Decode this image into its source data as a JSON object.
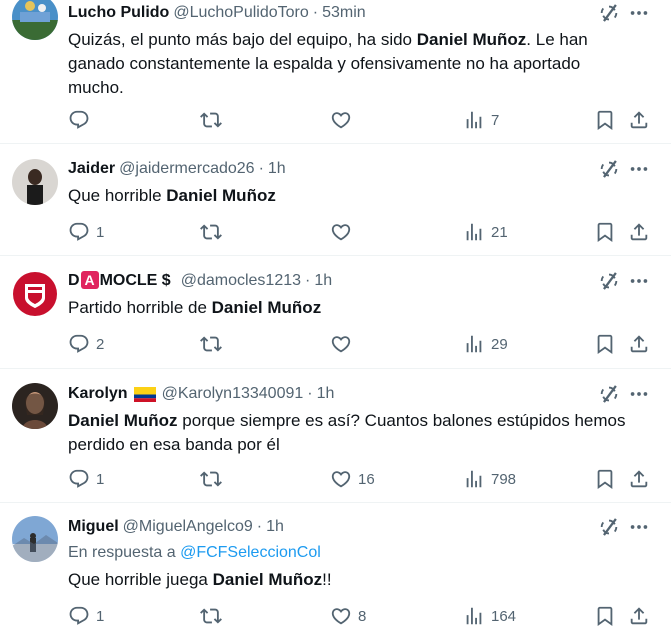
{
  "tweets": [
    {
      "name": "Lucho Pulido",
      "handle": "@LuchoPulidoToro",
      "time": "53min",
      "reply_to_prefix": "",
      "reply_to_handle": "",
      "body": [
        {
          "t": "Quizás, el punto más bajo del equipo, ha sido "
        },
        {
          "t": "Daniel Muñoz",
          "b": true
        },
        {
          "t": ". Le han ganado constantemente la espalda y ofensivamente no ha aportado mucho."
        }
      ],
      "replies": "",
      "retweets": "",
      "likes": "",
      "views": "7"
    },
    {
      "name": "Jaider",
      "handle": "@jaidermercado26",
      "time": "1h",
      "body": [
        {
          "t": "Que horrible "
        },
        {
          "t": "Daniel Muñoz",
          "b": true
        }
      ],
      "replies": "1",
      "retweets": "",
      "likes": "",
      "views": "21"
    },
    {
      "name_parts": [
        "D",
        "A",
        "MOCLE",
        "$"
      ],
      "handle": "@damocles1213",
      "time": "1h",
      "body": [
        {
          "t": "Partido horrible de "
        },
        {
          "t": "Daniel Muñoz",
          "b": true
        }
      ],
      "replies": "2",
      "retweets": "",
      "likes": "",
      "views": "29"
    },
    {
      "name": "Karolyn",
      "handle": "@Karolyn13340091",
      "time": "1h",
      "body": [
        {
          "t": "Daniel Muñoz",
          "b": true
        },
        {
          "t": " porque siempre es así? Cuantos balones estúpidos hemos perdido en esa banda por él"
        }
      ],
      "replies": "1",
      "retweets": "",
      "likes": "16",
      "views": "798"
    },
    {
      "name": "Miguel",
      "handle": "@MiguelAngelco9",
      "time": "1h",
      "reply_to_prefix": "En respuesta a ",
      "reply_to_handle": "@FCFSeleccionCol",
      "body": [
        {
          "t": "Que horrible juega "
        },
        {
          "t": "Daniel Muñoz",
          "b": true
        },
        {
          "t": "!!"
        }
      ],
      "replies": "1",
      "retweets": "",
      "likes": "8",
      "views": "164"
    }
  ],
  "separator": "·",
  "colors": {
    "text": "#0f1419",
    "secondary": "#536471",
    "link": "#1d9bf0",
    "border": "#eff3f4"
  },
  "icons": [
    "grok-icon",
    "more-icon",
    "reply-icon",
    "retweet-icon",
    "like-icon",
    "views-icon",
    "bookmark-icon",
    "share-icon"
  ]
}
